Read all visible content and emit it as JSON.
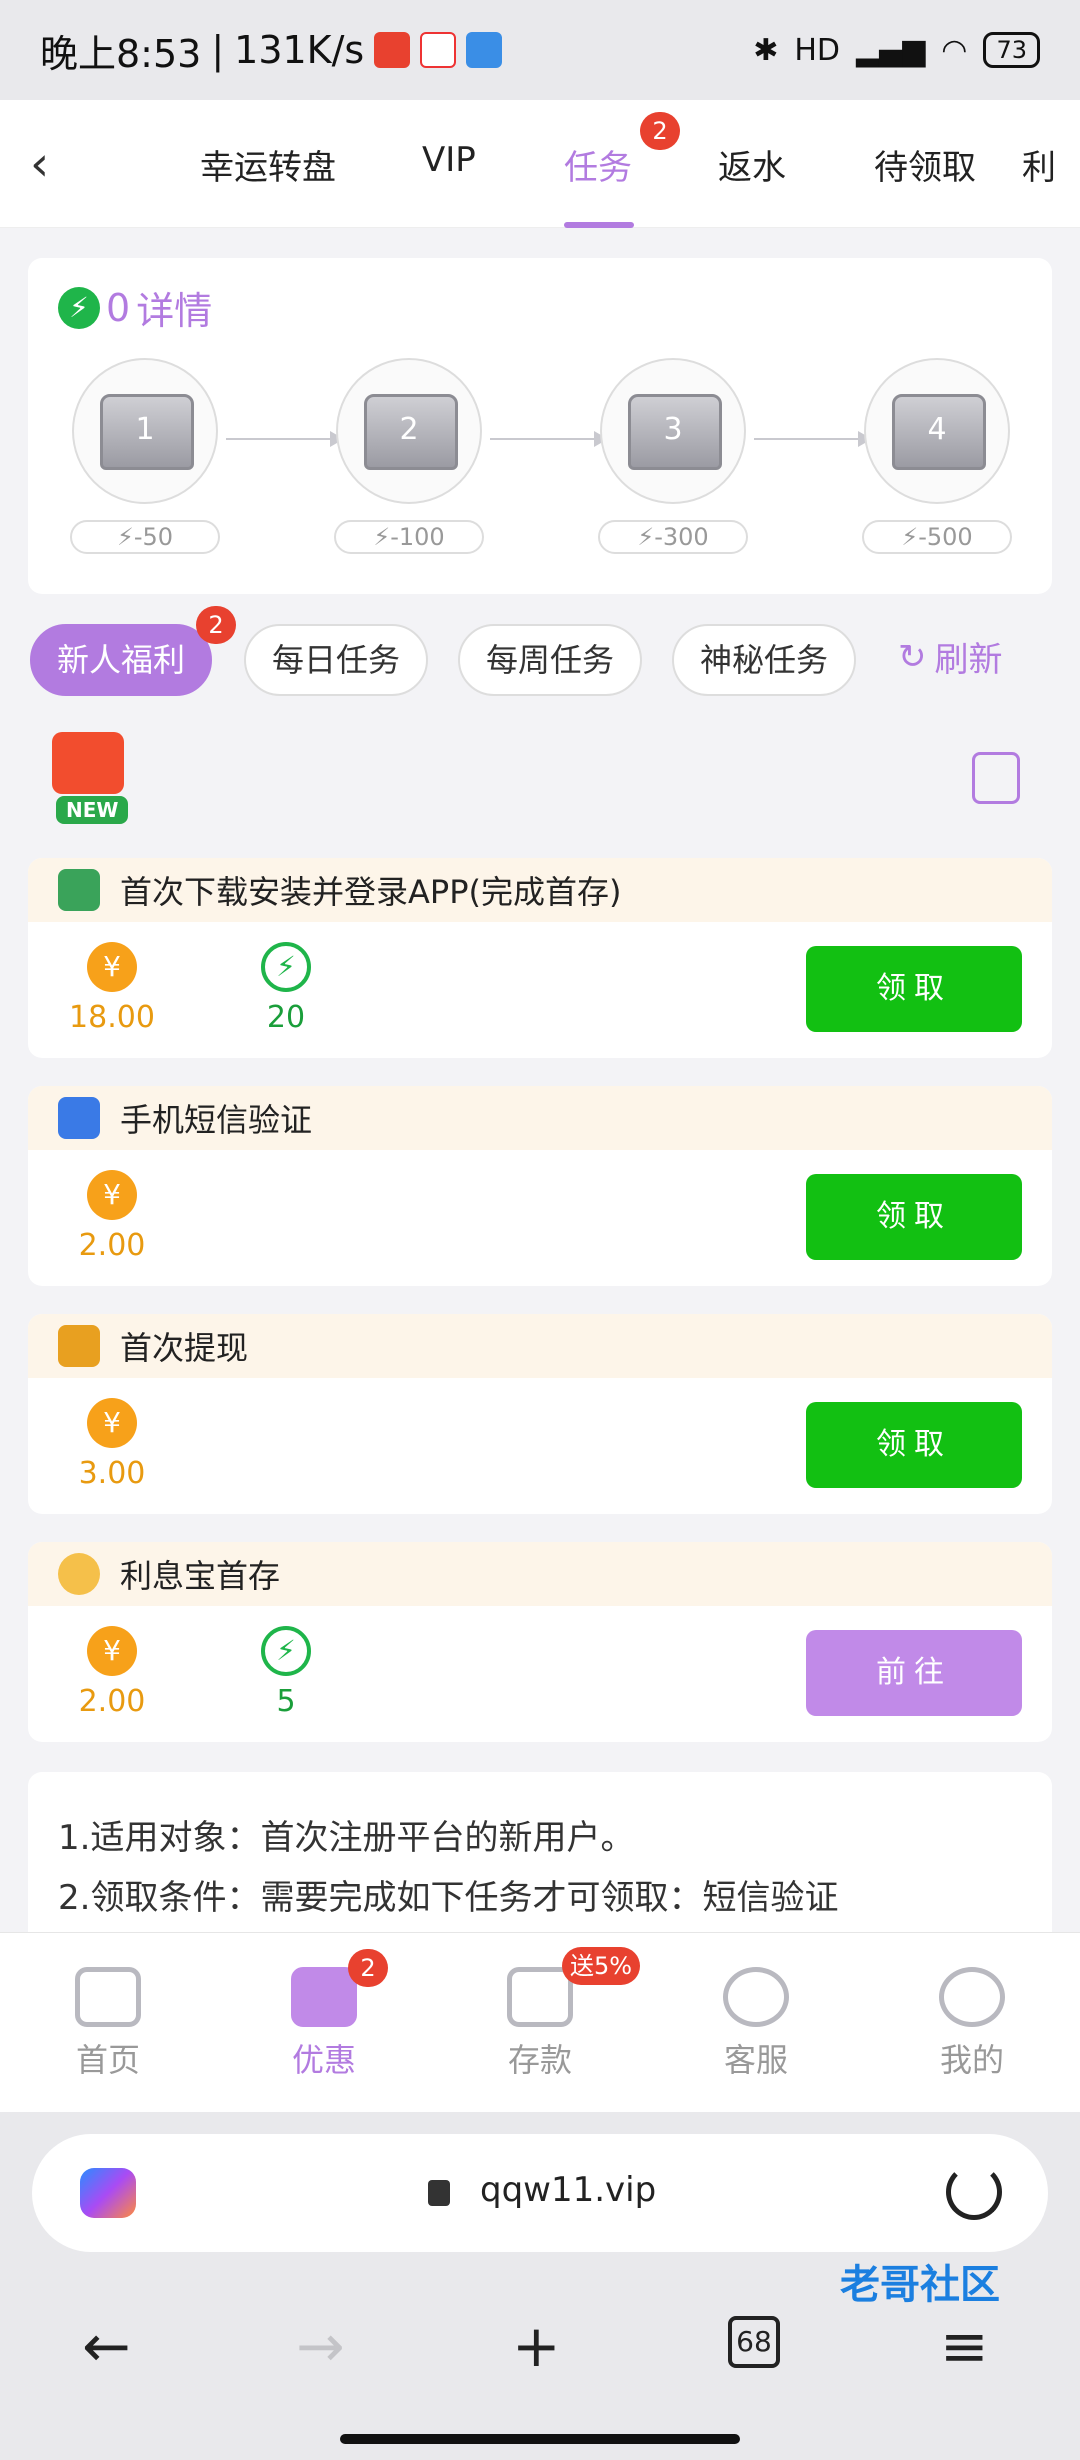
{
  "status": {
    "time": "晚上8:53",
    "speed": "131K/s",
    "battery": "73",
    "net": "HD"
  },
  "tabs": [
    {
      "label": "幸运转盘"
    },
    {
      "label": "VIP"
    },
    {
      "label": "任务",
      "badge": "2"
    },
    {
      "label": "返水"
    },
    {
      "label": "待领取"
    },
    {
      "label": "利"
    }
  ],
  "energy": {
    "count": "0",
    "details": "详情",
    "chests": [
      {
        "num": "1",
        "cost": "-50"
      },
      {
        "num": "2",
        "cost": "-100"
      },
      {
        "num": "3",
        "cost": "-300"
      },
      {
        "num": "4",
        "cost": "-500"
      }
    ]
  },
  "categories": [
    {
      "label": "新人福利",
      "badge": "2"
    },
    {
      "label": "每日任务"
    },
    {
      "label": "每周任务"
    },
    {
      "label": "神秘任务"
    }
  ],
  "refresh_label": "刷新",
  "new_label": "NEW",
  "tasks": [
    {
      "title": "首次下载安装并登录APP(完成首存)",
      "coin": "18.00",
      "bolt": "20",
      "action": "领取"
    },
    {
      "title": "手机短信验证",
      "coin": "2.00",
      "action": "领取"
    },
    {
      "title": "首次提现",
      "coin": "3.00",
      "action": "领取"
    },
    {
      "title": "利息宝首存",
      "coin": "2.00",
      "bolt": "5",
      "action": "前往"
    }
  ],
  "rules": [
    "1.适用对象：首次注册平台的新用户。",
    "2.领取条件：需要完成如下任务才可领取：短信验证"
  ],
  "bottom_nav": [
    {
      "label": "首页"
    },
    {
      "label": "优惠",
      "badge": "2"
    },
    {
      "label": "存款",
      "badge": "送5%"
    },
    {
      "label": "客服"
    },
    {
      "label": "我的"
    }
  ],
  "browser": {
    "url": "qqw11.vip",
    "tab_count": "68"
  },
  "watermark": "老哥社区",
  "colors": {
    "accent": "#b27be0",
    "claim_green": "#12c012",
    "go_purple": "#c18ae8",
    "coin": "#f7a11a",
    "badge_red": "#e8412f"
  }
}
